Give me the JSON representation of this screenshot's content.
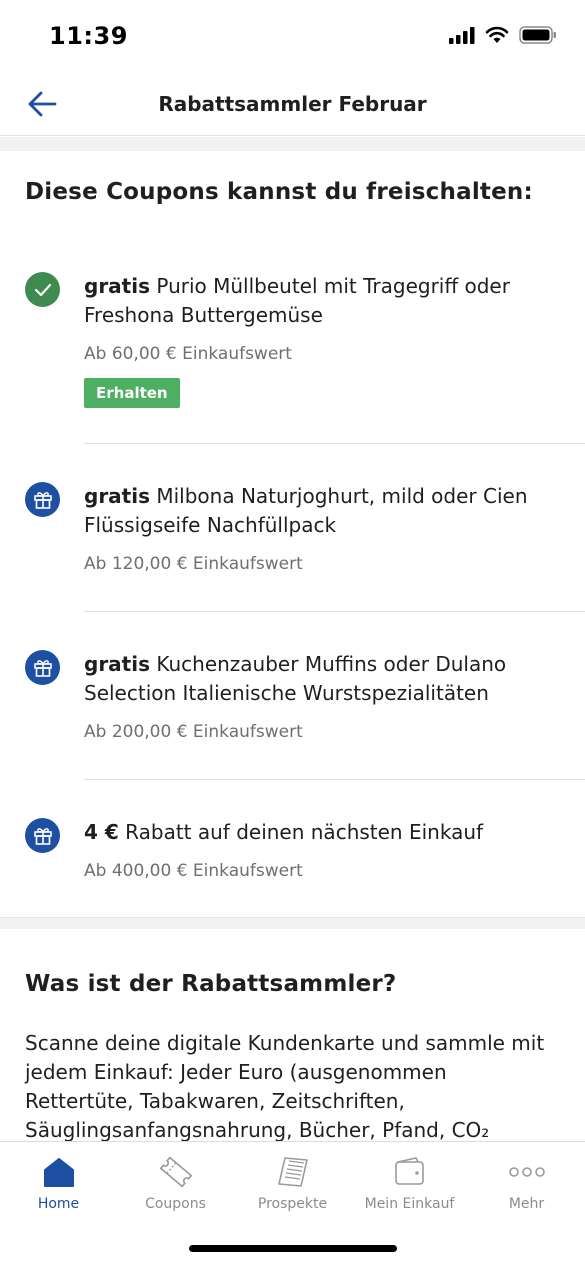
{
  "status": {
    "time": "11:39"
  },
  "header": {
    "title": "Rabattsammler Februar",
    "back_icon": "arrow-left-icon"
  },
  "coupons_section": {
    "title": "Diese Coupons kannst du freischalten:",
    "items": [
      {
        "bold": "gratis",
        "text": " Purio Müllbeutel mit Tragegriff oder Freshona Buttergemüse",
        "threshold": "Ab 60,00 € Einkaufswert",
        "state": "received",
        "badge": "Erhalten",
        "icon": "check-icon"
      },
      {
        "bold": "gratis",
        "text": " Milbona Naturjoghurt, mild oder Cien Flüssigseife Nachfüllpack",
        "threshold": "Ab 120,00 € Einkaufswert",
        "state": "locked",
        "icon": "gift-icon"
      },
      {
        "bold": "gratis",
        "text": " Kuchenzauber Muffins oder Dulano Selection Italienische Wurstspezialitäten",
        "threshold": "Ab 200,00 € Einkaufswert",
        "state": "locked",
        "icon": "gift-icon"
      },
      {
        "bold": "4 €",
        "text": " Rabatt auf deinen nächsten Einkauf",
        "threshold": "Ab 400,00 € Einkaufswert",
        "state": "locked",
        "icon": "gift-icon"
      }
    ]
  },
  "info_section": {
    "title": "Was ist der Rabattsammler?",
    "body": "Scanne deine digitale Kundenkarte und sammle mit jedem Einkauf: Jeder Euro (ausgenommen Rettertüte, Tabakwaren, Zeitschriften, Säuglingsanfangsnahrung, Bücher, Pfand, CO₂"
  },
  "tabbar": {
    "items": [
      {
        "label": "Home",
        "icon": "home-icon",
        "active": true
      },
      {
        "label": "Coupons",
        "icon": "coupon-icon",
        "active": false
      },
      {
        "label": "Prospekte",
        "icon": "brochure-icon",
        "active": false
      },
      {
        "label": "Mein Einkauf",
        "icon": "wallet-icon",
        "active": false
      },
      {
        "label": "Mehr",
        "icon": "more-icon",
        "active": false
      }
    ]
  },
  "colors": {
    "accent": "#1d4fa3",
    "success": "#3f8a4f",
    "badge": "#4caf62"
  }
}
